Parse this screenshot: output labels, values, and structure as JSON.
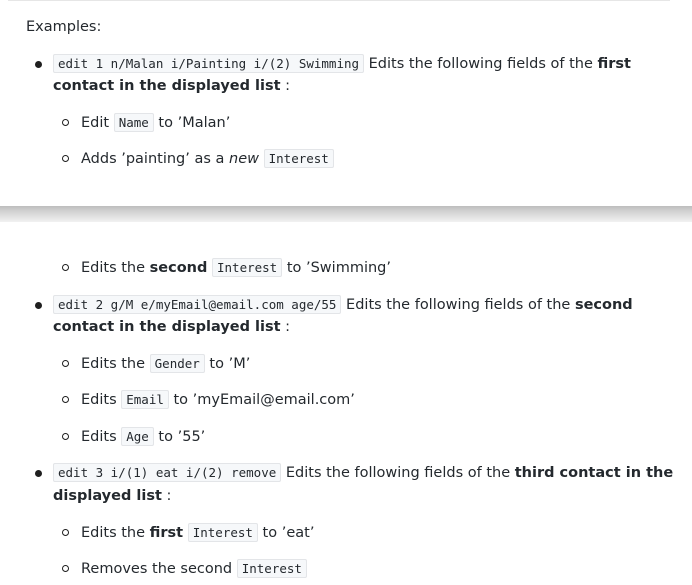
{
  "heading": "Examples:",
  "part1": {
    "ex1": {
      "cmd": "edit 1 n/Malan i/Painting i/(2) Swimming",
      "desc_pre": " Edits the following fields of the ",
      "desc_bold1": "first",
      "desc_bold2": "contact in the displayed list",
      "desc_post": " :"
    },
    "sub1": {
      "pre": "Edit ",
      "code": "Name",
      "post": " to ’Malan’"
    },
    "sub2": {
      "pre": "Adds ’painting’ as a ",
      "em": "new",
      "code": "Interest"
    }
  },
  "part2": {
    "sub3": {
      "pre": "Edits the ",
      "bold": "second",
      "code": "Interest",
      "post": " to ’Swimming’"
    },
    "ex2": {
      "cmd": "edit 2 g/M e/myEmail@email.com age/55",
      "desc_pre": " Edits the following fields of the ",
      "desc_bold1": "second",
      "desc_bold2": "contact in the displayed list",
      "desc_post": " :"
    },
    "sub4": {
      "pre": "Edits the ",
      "code": "Gender",
      "post": " to ’M’"
    },
    "sub5": {
      "pre": "Edits ",
      "code": "Email",
      "post": " to ’myEmail@email.com’"
    },
    "sub6": {
      "pre": "Edits ",
      "code": "Age",
      "post": " to ’55’"
    },
    "ex3": {
      "cmd": "edit 3 i/(1) eat i/(2) remove",
      "desc_pre": " Edits the following fields of the ",
      "desc_bold1": "third contact in the",
      "desc_bold2": "displayed list",
      "desc_post": " :"
    },
    "sub7": {
      "pre": "Edits the ",
      "bold": "first",
      "code": "Interest",
      "post": " to ’eat’"
    },
    "sub8": {
      "pre": "Removes the second ",
      "code": "Interest"
    }
  }
}
